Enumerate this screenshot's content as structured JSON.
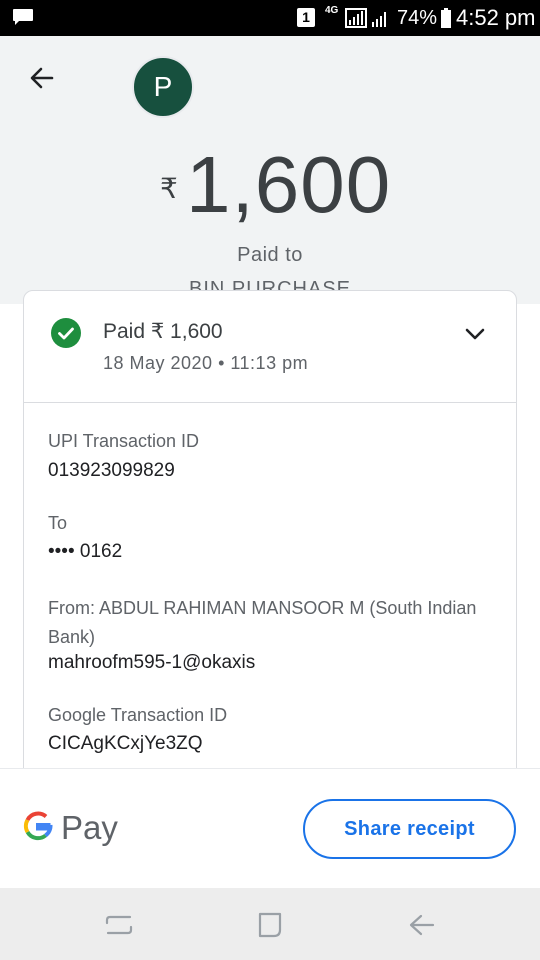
{
  "status_bar": {
    "sim_slot": "1",
    "network_type": "4G",
    "battery_percent": "74%",
    "time": "4:52 pm",
    "icons": [
      "message-icon",
      "signal-icon",
      "battery-icon"
    ]
  },
  "header": {
    "back_icon": "arrow-left-icon",
    "avatar_letter": "P",
    "currency_symbol": "₹",
    "amount": "1,600",
    "paid_to_label": "Paid to",
    "payee_name": "BIN PURCHASE"
  },
  "card": {
    "status_title": "Paid ₹ 1,600",
    "status_date": "18 May 2020 • 11:13 pm",
    "details": [
      {
        "label": "UPI Transaction ID",
        "value": "013923099829"
      },
      {
        "label": "To",
        "value": "•••• 0162"
      },
      {
        "label": "From: ABDUL RAHIMAN MANSOOR M (South Indian Bank)",
        "value": "mahroofm595-1@okaxis"
      },
      {
        "label": "Google Transaction ID",
        "value": "CICAgKCxjYe3ZQ"
      }
    ]
  },
  "bottom": {
    "brand_pay": "Pay",
    "share_label": "Share receipt"
  },
  "colors": {
    "accent": "#1a73e8",
    "success": "#1e8e3e",
    "avatar": "#17503e"
  }
}
